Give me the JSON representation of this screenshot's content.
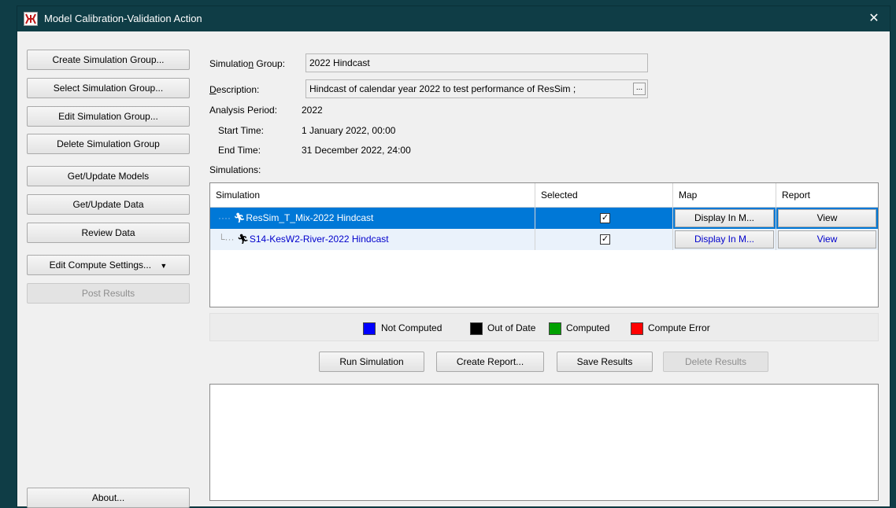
{
  "window": {
    "title": "Model Calibration-Validation Action",
    "close_glyph": "✕"
  },
  "sidebar": {
    "create_group": "Create Simulation Group...",
    "select_group": "Select Simulation Group...",
    "edit_group": "Edit Simulation Group...",
    "delete_group": "Delete Simulation Group",
    "get_models": "Get/Update Models",
    "get_data": "Get/Update Data",
    "review_data": "Review Data",
    "compute_settings": "Edit Compute Settings...",
    "post_results": "Post Results",
    "about": "About..."
  },
  "form": {
    "group_label_pre": "Simulatio",
    "group_label_u": "n",
    "group_label_post": " Group:",
    "group_value": "2022 Hindcast",
    "description_label_u": "D",
    "description_label_post": "escription:",
    "description_value": "Hindcast of calendar year 2022 to test performance of ResSim ;",
    "description_btn": "...",
    "analysis_label": "Analysis Period:",
    "analysis_value": "2022",
    "start_label": "Start Time:",
    "start_value": "1 January 2022, 00:00",
    "end_label": "End Time:",
    "end_value": "31 December 2022, 24:00",
    "simulations_label": "Simulations:"
  },
  "table": {
    "columns": [
      "Simulation",
      "Selected",
      "Map",
      "Report"
    ],
    "rows": [
      {
        "name": "ResSim_T_Mix-2022 Hindcast",
        "selected": true,
        "map": "Display In M...",
        "report": "View"
      },
      {
        "name": "S14-KesW2-River-2022 Hindcast",
        "selected": true,
        "map": "Display In M...",
        "report": "View"
      }
    ]
  },
  "legend": {
    "items": [
      {
        "label": "Not Computed",
        "color": "#0000ff"
      },
      {
        "label": "Out of Date",
        "color": "#000000"
      },
      {
        "label": "Computed",
        "color": "#00a000"
      },
      {
        "label": "Compute Error",
        "color": "#ff0000"
      }
    ]
  },
  "actions": {
    "run": "Run Simulation",
    "create_report": "Create Report...",
    "save": "Save Results",
    "delete": "Delete Results"
  },
  "colors": {
    "selected_row": "#0078d7",
    "not_computed_text": "#0000cc",
    "titlebar": "#0f3d46"
  }
}
